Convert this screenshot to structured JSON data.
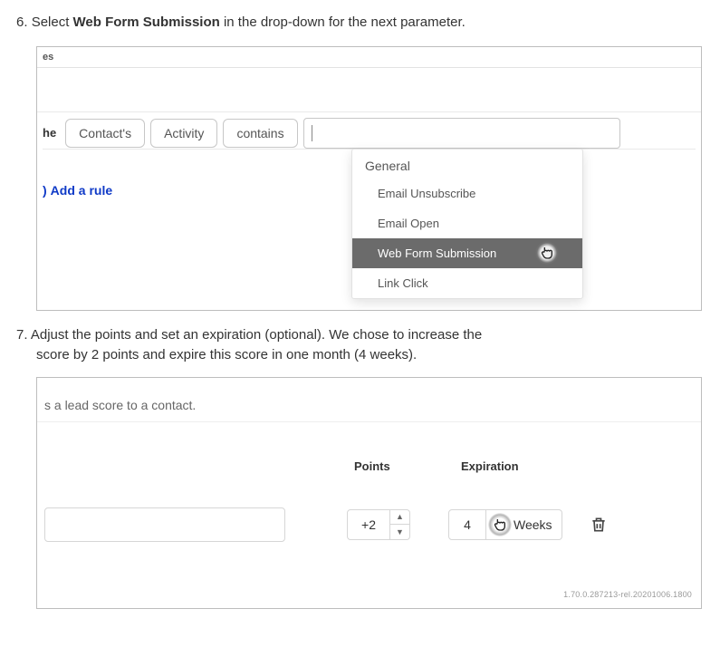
{
  "step6": {
    "number": "6.",
    "text_before": "Select ",
    "bold": "Web Form Submission",
    "text_after": " in the drop-down for the next parameter."
  },
  "panelA": {
    "es": "es",
    "he": "he",
    "chips": {
      "contacts": "Contact's",
      "activity": "Activity",
      "contains": "contains"
    },
    "addRule": {
      "paren": ")",
      "label": "Add a rule"
    },
    "dropdown": {
      "section": "General",
      "items": [
        "Email Unsubscribe",
        "Email Open",
        "Web Form Submission",
        "Link Click"
      ],
      "hoveredIndex": 2
    }
  },
  "step7": {
    "number": "7.",
    "line1": "Adjust the points and set an expiration (optional). We chose to increase the",
    "line2": "score by 2 points and expire this score in one month (4 weeks)."
  },
  "panelB": {
    "leadText": "s a lead score to a contact.",
    "headers": {
      "points": "Points",
      "expiration": "Expiration"
    },
    "pointsValue": "+2",
    "expValue": "4",
    "expUnit": "Weeks",
    "footerId": "1.70.0.287213-rel.20201006.1800"
  }
}
